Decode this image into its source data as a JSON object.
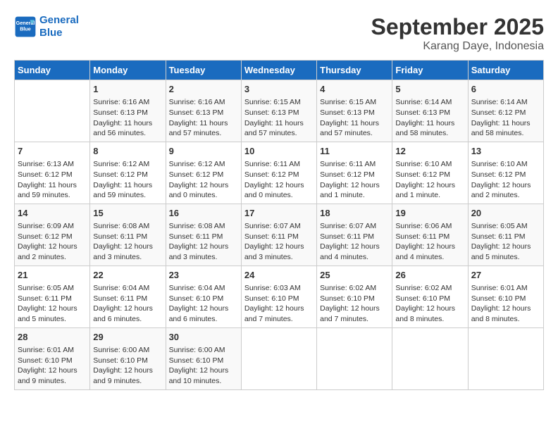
{
  "logo": {
    "line1": "General",
    "line2": "Blue"
  },
  "title": "September 2025",
  "subtitle": "Karang Daye, Indonesia",
  "weekdays": [
    "Sunday",
    "Monday",
    "Tuesday",
    "Wednesday",
    "Thursday",
    "Friday",
    "Saturday"
  ],
  "weeks": [
    [
      {
        "day": "",
        "sunrise": "",
        "sunset": "",
        "daylight": ""
      },
      {
        "day": "1",
        "sunrise": "Sunrise: 6:16 AM",
        "sunset": "Sunset: 6:13 PM",
        "daylight": "Daylight: 11 hours and 56 minutes."
      },
      {
        "day": "2",
        "sunrise": "Sunrise: 6:16 AM",
        "sunset": "Sunset: 6:13 PM",
        "daylight": "Daylight: 11 hours and 57 minutes."
      },
      {
        "day": "3",
        "sunrise": "Sunrise: 6:15 AM",
        "sunset": "Sunset: 6:13 PM",
        "daylight": "Daylight: 11 hours and 57 minutes."
      },
      {
        "day": "4",
        "sunrise": "Sunrise: 6:15 AM",
        "sunset": "Sunset: 6:13 PM",
        "daylight": "Daylight: 11 hours and 57 minutes."
      },
      {
        "day": "5",
        "sunrise": "Sunrise: 6:14 AM",
        "sunset": "Sunset: 6:13 PM",
        "daylight": "Daylight: 11 hours and 58 minutes."
      },
      {
        "day": "6",
        "sunrise": "Sunrise: 6:14 AM",
        "sunset": "Sunset: 6:12 PM",
        "daylight": "Daylight: 11 hours and 58 minutes."
      }
    ],
    [
      {
        "day": "7",
        "sunrise": "Sunrise: 6:13 AM",
        "sunset": "Sunset: 6:12 PM",
        "daylight": "Daylight: 11 hours and 59 minutes."
      },
      {
        "day": "8",
        "sunrise": "Sunrise: 6:12 AM",
        "sunset": "Sunset: 6:12 PM",
        "daylight": "Daylight: 11 hours and 59 minutes."
      },
      {
        "day": "9",
        "sunrise": "Sunrise: 6:12 AM",
        "sunset": "Sunset: 6:12 PM",
        "daylight": "Daylight: 12 hours and 0 minutes."
      },
      {
        "day": "10",
        "sunrise": "Sunrise: 6:11 AM",
        "sunset": "Sunset: 6:12 PM",
        "daylight": "Daylight: 12 hours and 0 minutes."
      },
      {
        "day": "11",
        "sunrise": "Sunrise: 6:11 AM",
        "sunset": "Sunset: 6:12 PM",
        "daylight": "Daylight: 12 hours and 1 minute."
      },
      {
        "day": "12",
        "sunrise": "Sunrise: 6:10 AM",
        "sunset": "Sunset: 6:12 PM",
        "daylight": "Daylight: 12 hours and 1 minute."
      },
      {
        "day": "13",
        "sunrise": "Sunrise: 6:10 AM",
        "sunset": "Sunset: 6:12 PM",
        "daylight": "Daylight: 12 hours and 2 minutes."
      }
    ],
    [
      {
        "day": "14",
        "sunrise": "Sunrise: 6:09 AM",
        "sunset": "Sunset: 6:12 PM",
        "daylight": "Daylight: 12 hours and 2 minutes."
      },
      {
        "day": "15",
        "sunrise": "Sunrise: 6:08 AM",
        "sunset": "Sunset: 6:11 PM",
        "daylight": "Daylight: 12 hours and 3 minutes."
      },
      {
        "day": "16",
        "sunrise": "Sunrise: 6:08 AM",
        "sunset": "Sunset: 6:11 PM",
        "daylight": "Daylight: 12 hours and 3 minutes."
      },
      {
        "day": "17",
        "sunrise": "Sunrise: 6:07 AM",
        "sunset": "Sunset: 6:11 PM",
        "daylight": "Daylight: 12 hours and 3 minutes."
      },
      {
        "day": "18",
        "sunrise": "Sunrise: 6:07 AM",
        "sunset": "Sunset: 6:11 PM",
        "daylight": "Daylight: 12 hours and 4 minutes."
      },
      {
        "day": "19",
        "sunrise": "Sunrise: 6:06 AM",
        "sunset": "Sunset: 6:11 PM",
        "daylight": "Daylight: 12 hours and 4 minutes."
      },
      {
        "day": "20",
        "sunrise": "Sunrise: 6:05 AM",
        "sunset": "Sunset: 6:11 PM",
        "daylight": "Daylight: 12 hours and 5 minutes."
      }
    ],
    [
      {
        "day": "21",
        "sunrise": "Sunrise: 6:05 AM",
        "sunset": "Sunset: 6:11 PM",
        "daylight": "Daylight: 12 hours and 5 minutes."
      },
      {
        "day": "22",
        "sunrise": "Sunrise: 6:04 AM",
        "sunset": "Sunset: 6:11 PM",
        "daylight": "Daylight: 12 hours and 6 minutes."
      },
      {
        "day": "23",
        "sunrise": "Sunrise: 6:04 AM",
        "sunset": "Sunset: 6:10 PM",
        "daylight": "Daylight: 12 hours and 6 minutes."
      },
      {
        "day": "24",
        "sunrise": "Sunrise: 6:03 AM",
        "sunset": "Sunset: 6:10 PM",
        "daylight": "Daylight: 12 hours and 7 minutes."
      },
      {
        "day": "25",
        "sunrise": "Sunrise: 6:02 AM",
        "sunset": "Sunset: 6:10 PM",
        "daylight": "Daylight: 12 hours and 7 minutes."
      },
      {
        "day": "26",
        "sunrise": "Sunrise: 6:02 AM",
        "sunset": "Sunset: 6:10 PM",
        "daylight": "Daylight: 12 hours and 8 minutes."
      },
      {
        "day": "27",
        "sunrise": "Sunrise: 6:01 AM",
        "sunset": "Sunset: 6:10 PM",
        "daylight": "Daylight: 12 hours and 8 minutes."
      }
    ],
    [
      {
        "day": "28",
        "sunrise": "Sunrise: 6:01 AM",
        "sunset": "Sunset: 6:10 PM",
        "daylight": "Daylight: 12 hours and 9 minutes."
      },
      {
        "day": "29",
        "sunrise": "Sunrise: 6:00 AM",
        "sunset": "Sunset: 6:10 PM",
        "daylight": "Daylight: 12 hours and 9 minutes."
      },
      {
        "day": "30",
        "sunrise": "Sunrise: 6:00 AM",
        "sunset": "Sunset: 6:10 PM",
        "daylight": "Daylight: 12 hours and 10 minutes."
      },
      {
        "day": "",
        "sunrise": "",
        "sunset": "",
        "daylight": ""
      },
      {
        "day": "",
        "sunrise": "",
        "sunset": "",
        "daylight": ""
      },
      {
        "day": "",
        "sunrise": "",
        "sunset": "",
        "daylight": ""
      },
      {
        "day": "",
        "sunrise": "",
        "sunset": "",
        "daylight": ""
      }
    ]
  ]
}
